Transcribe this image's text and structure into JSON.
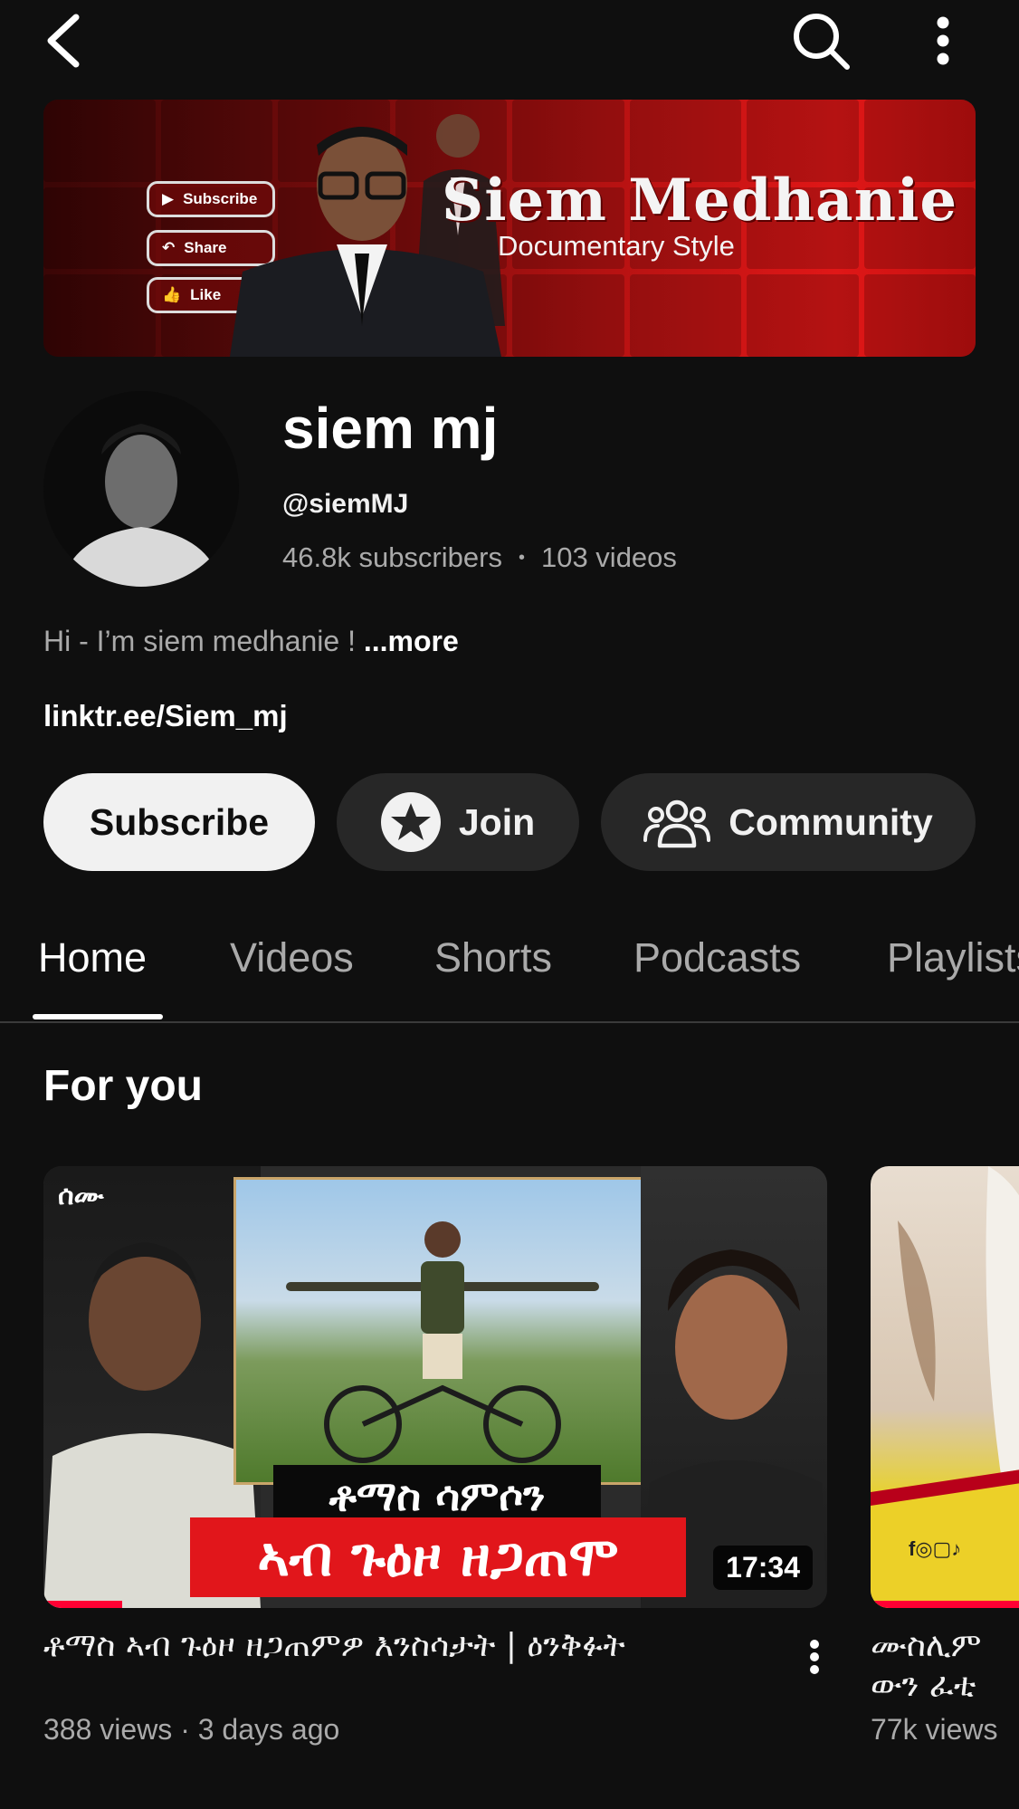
{
  "banner": {
    "title": "Siem Medhanie",
    "subtitle": "Documentary Style",
    "pills": [
      "Subscribe",
      "Share",
      "Like"
    ]
  },
  "channel": {
    "name": "siem mj",
    "handle": "@siemMJ",
    "subscribers": "46.8k subscribers",
    "separator": "•",
    "videos": "103 videos",
    "description": "Hi - I’m siem medhanie !",
    "more_label": "...more",
    "link": "linktr.ee/Siem_mj"
  },
  "actions": {
    "subscribe_label": "Subscribe",
    "join_label": "Join",
    "community_label": "Community"
  },
  "tabs": [
    {
      "label": "Home",
      "active": true
    },
    {
      "label": "Videos"
    },
    {
      "label": "Shorts"
    },
    {
      "label": "Podcasts"
    },
    {
      "label": "Playlists"
    }
  ],
  "section": {
    "title": "For you"
  },
  "videos": [
    {
      "thumb_caption_top": "ቶማስ ሳምሶን",
      "thumb_caption_bottom": "ኣብ ጉዕዞ ዘጋጠሞ",
      "thumb_logo": "ሰሙ",
      "duration": "17:34",
      "progress": 0.1,
      "title": "ቶማስ ኣብ ጉዕዞ ዘጋጠምዎ እንስሳታት | ዕንቅፉት",
      "meta": "388 views · 3 days ago"
    },
    {
      "thumb_icons": "f◎▢♪",
      "title_line1": "ሙስሊም",
      "title_line2": "ውን ፈቲ",
      "meta": "77k views"
    }
  ],
  "colors": {
    "background": "#0f0f0f",
    "accent_red": "#ff0033",
    "secondary_text": "#aaaaaa",
    "chip_bg": "#272727"
  },
  "icons": [
    "back-arrow-icon",
    "search-icon",
    "more-vert-icon",
    "star-icon",
    "community-icon",
    "more-vert-icon"
  ]
}
